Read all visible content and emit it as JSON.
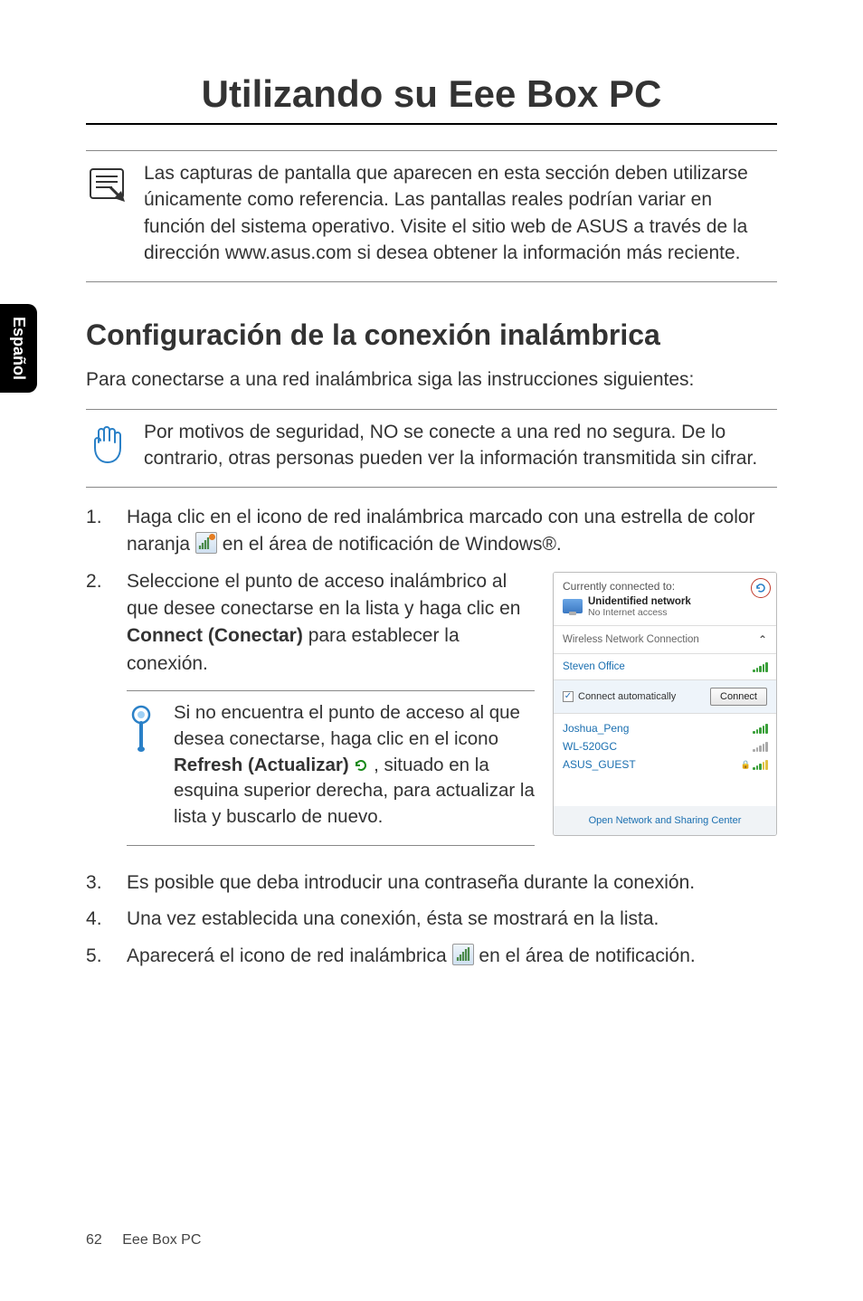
{
  "sideTab": "Español",
  "title": "Utilizando su Eee Box PC",
  "introNote": "Las capturas de pantalla que aparecen en esta sección deben utilizarse únicamente como referencia. Las pantallas reales podrían variar en función del sistema operativo. Visite el sitio web de ASUS a través de la dirección www.asus.com si desea obtener la información más reciente.",
  "sectionHeading": "Configuración de la conexión inalámbrica",
  "sectionIntro": "Para conectarse a una red inalámbrica siga las instrucciones siguientes:",
  "securityNote": "Por motivos de seguridad, NO se conecte a una red no segura. De lo contrario, otras personas pueden ver la información transmitida sin cifrar.",
  "step1_before": "Haga clic en el icono de red inalámbrica marcado con una estrella de color naranja ",
  "step1_after": " en el área de notificación de Windows®.",
  "step2_a": "Seleccione el punto de acceso inalámbrico al que desee conectarse en la lista y haga clic en ",
  "step2_bold": "Connect (Conectar)",
  "step2_b": " para establecer la conexión.",
  "tip_a": "Si no encuentra el punto de acceso al que desea conectarse, haga clic en el icono ",
  "tip_bold": "Refresh (Actualizar)",
  "tip_b": " , situado en la esquina superior derecha, para actualizar la lista y buscarlo de nuevo.",
  "step3": "Es posible que deba introducir una contraseña durante la conexión.",
  "step4": "Una vez establecida una conexión, ésta se mostrará en la lista.",
  "step5_a": "Aparecerá el icono de red inalámbrica ",
  "step5_b": " en el área de notificación.",
  "figure": {
    "connectedTo": "Currently connected to:",
    "unidentified": "Unidentified network",
    "noAccess": "No Internet access",
    "wirelessConn": "Wireless Network Connection",
    "selectedNet": "Steven Office",
    "autoConnect": "Connect automatically",
    "connectBtn": "Connect",
    "nets": [
      "Joshua_Peng",
      "WL-520GC",
      "ASUS_GUEST"
    ],
    "footerLink": "Open Network and Sharing Center"
  },
  "footer": {
    "page": "62",
    "doc": "Eee Box PC"
  }
}
